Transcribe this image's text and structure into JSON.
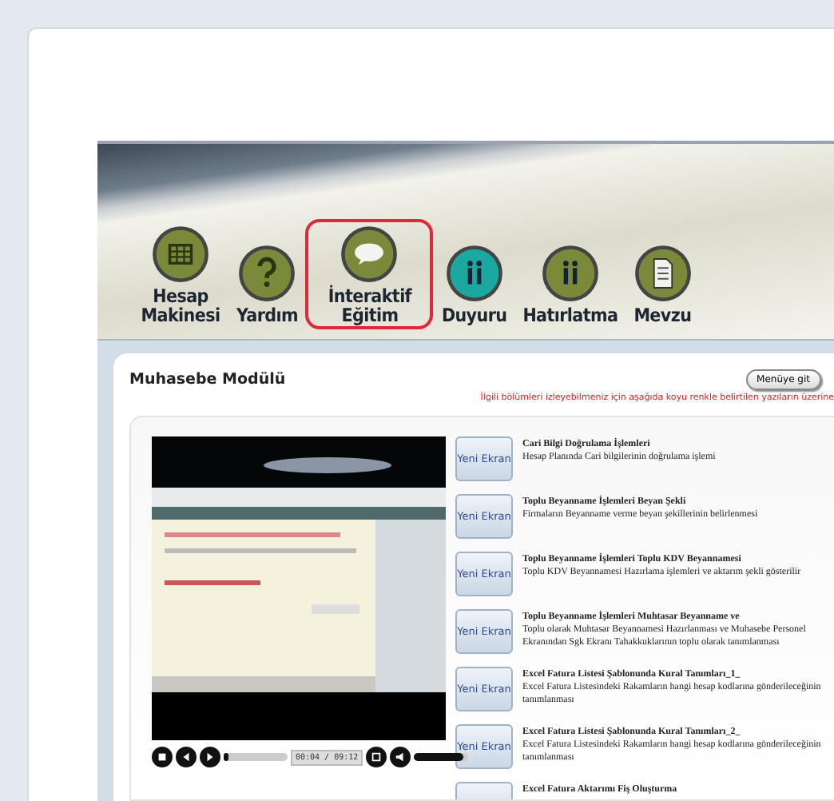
{
  "toolbar": [
    {
      "label": "Hesap Makinesi",
      "kind": "calculator",
      "color": "#7a8a3a",
      "selected": false
    },
    {
      "label": "Yardım",
      "kind": "help",
      "color": "#7a8a3a",
      "selected": false
    },
    {
      "label": "İnteraktif Eğitim",
      "kind": "chat",
      "color": "#7a8a3a",
      "selected": true
    },
    {
      "label": "Duyuru",
      "kind": "info",
      "color": "#1aa8a0",
      "selected": false
    },
    {
      "label": "Hatırlatma",
      "kind": "info",
      "color": "#7a8a3a",
      "selected": false
    },
    {
      "label": "Mevzu",
      "kind": "document",
      "color": "#7a8a3a",
      "selected": false
    }
  ],
  "module": {
    "title": "Muhasebe Modülü",
    "menu_button": "Menüye git",
    "notice": "İlgili bölümleri izleyebilmeniz için aşağıda koyu renkle belirtilen yazıların üzerine"
  },
  "player": {
    "time": "00:04 / 09:12",
    "progress": {
      "level": 0.08
    },
    "volume": {
      "level": 0.9
    }
  },
  "lessons": [
    {
      "button": "Yeni Ekran",
      "title": "Cari Bilgi Doğrulama İşlemleri",
      "description": "Hesap Planında Cari bilgilerinin doğrulama işlemi"
    },
    {
      "button": "Yeni Ekran",
      "title": "Toplu Beyanname İşlemleri Beyan Şekli",
      "description": "Firmaların Beyanname verme beyan şekillerinin belirlenmesi"
    },
    {
      "button": "Yeni Ekran",
      "title": "Toplu Beyanname İşlemleri Toplu KDV Beyannamesi",
      "description": "Toplu KDV Beyannamesi Hazırlama işlemleri ve aktarım şekli gösterilir"
    },
    {
      "button": "Yeni Ekran",
      "title": "Toplu Beyanname İşlemleri Muhtasar Beyanname ve",
      "description": "Toplu olarak Muhtasar Beyannamesi Hazırlanması ve Muhasebe Personel Ekranından Sgk Ekranı Tahakkuklarının toplu olarak tanımlanması"
    },
    {
      "button": "Yeni Ekran",
      "title": "Excel Fatura Listesi Şablonunda Kural Tanımları_1_",
      "description": "Excel Fatura Listesindeki Rakamların hangi hesap kodlarına gönderileceğinin tanımlanması"
    },
    {
      "button": "Yeni Ekran",
      "title": "Excel Fatura Listesi Şablonunda Kural Tanımları_2_",
      "description": "Excel Fatura Listesindeki Rakamların hangi hesap kodlarına gönderileceğinin tanımlanması"
    },
    {
      "title": "Excel Fatura Aktarımı Fiş Oluşturma"
    }
  ]
}
